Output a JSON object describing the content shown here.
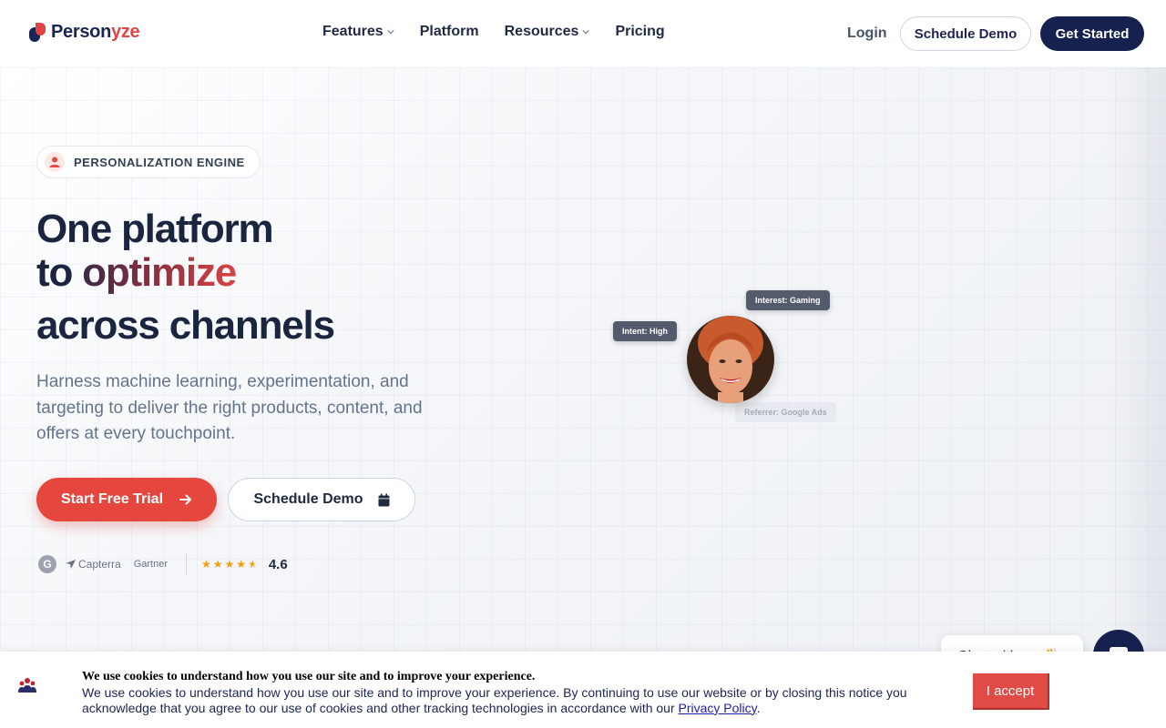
{
  "nav": {
    "logo_text_main": "Person",
    "logo_text_accent": "yze",
    "menu": [
      {
        "label": "Features",
        "has_dropdown": true
      },
      {
        "label": "Platform",
        "has_dropdown": false
      },
      {
        "label": "Resources",
        "has_dropdown": true
      },
      {
        "label": "Pricing",
        "has_dropdown": false
      }
    ],
    "login": "Login",
    "schedule_demo": "Schedule Demo",
    "get_started": "Get Started"
  },
  "hero": {
    "badge": "PERSONALIZATION ENGINE",
    "headline_line1": "One platform",
    "headline_line2_prefix": "to",
    "headline_line2_accent": "optimize",
    "headline_line3": "across channels",
    "subtitle": "Harness machine learning, experimentation, and targeting to deliver the right products, content, and offers at every touchpoint.",
    "cta_primary": "Start Free Trial",
    "cta_secondary": "Schedule Demo",
    "ratings": {
      "g2": "G",
      "capterra": "Capterra",
      "gartner": "Gartner",
      "stars": 4.6,
      "score": "4.6"
    },
    "tags": {
      "interest": "Interest: Gaming",
      "intent": "Intent: High",
      "referrer": "Referrer: Google Ads"
    }
  },
  "chat": {
    "label": "Chat with us 👋"
  },
  "cookie": {
    "title": "We use cookies to understand how you use our site and to improve your experience.",
    "body": "We use cookies to understand how you use our site and to improve your experience. By continuing to use our website or by closing this notice you acknowledge that you agree to our use of cookies and other tracking technologies in accordance with our",
    "link": "Privacy Policy",
    "accept": "I accept"
  },
  "colors": {
    "brand_navy": "#16214f",
    "brand_red": "#e5473f"
  }
}
